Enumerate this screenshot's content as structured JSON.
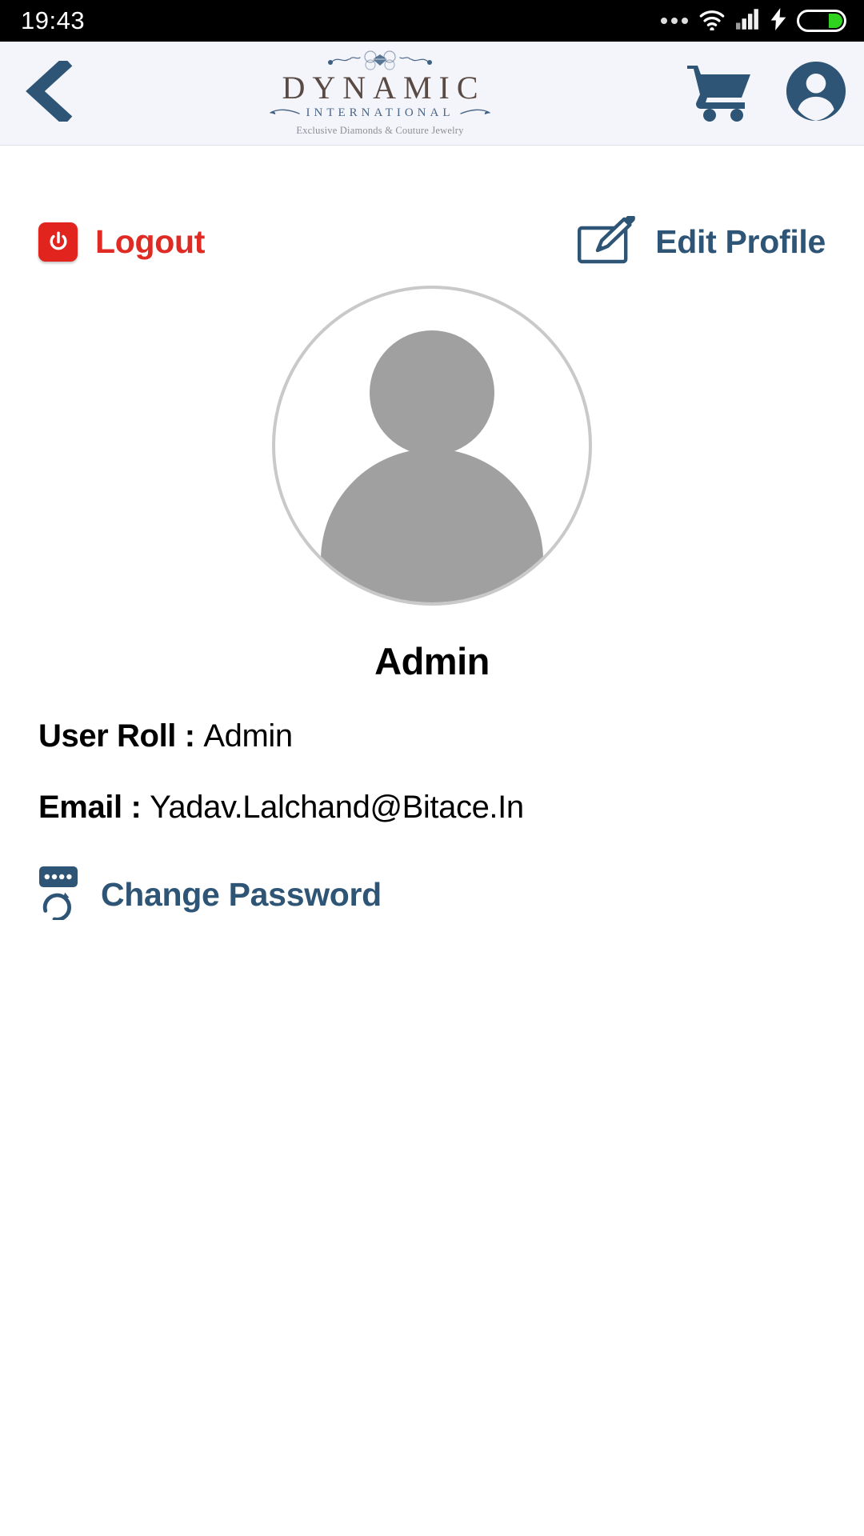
{
  "statusbar": {
    "time": "19:43",
    "icons": [
      "more-dots-icon",
      "wifi-icon",
      "cellular-signal-icon",
      "charging-bolt-icon",
      "battery-icon"
    ]
  },
  "appbar": {
    "back_icon": "chevron-left-icon",
    "logo": {
      "title": "DYNAMIC",
      "subtitle": "INTERNATIONAL",
      "tagline": "Exclusive Diamonds & Couture Jewelry"
    },
    "cart_icon": "shopping-cart-icon",
    "account_icon": "user-account-icon"
  },
  "actions": {
    "logout_label": "Logout",
    "logout_icon": "power-off-icon",
    "edit_profile_label": "Edit Profile",
    "edit_profile_icon": "edit-pencil-icon"
  },
  "profile": {
    "avatar_icon": "default-user-avatar",
    "name": "Admin",
    "fields": [
      {
        "label": "User Roll",
        "separator": " : ",
        "value": "Admin"
      },
      {
        "label": "Email",
        "separator": " : ",
        "value": "Yadav.Lalchand@Bitace.In"
      }
    ]
  },
  "change_password": {
    "label": "Change Password",
    "icon": "password-reset-icon"
  },
  "colors": {
    "brand_blue": "#2f5576",
    "logout_red": "#e02a24",
    "appbar_bg": "#f4f5fb",
    "avatar_gray": "#a0a0a0",
    "battery_green": "#2fd21f"
  }
}
